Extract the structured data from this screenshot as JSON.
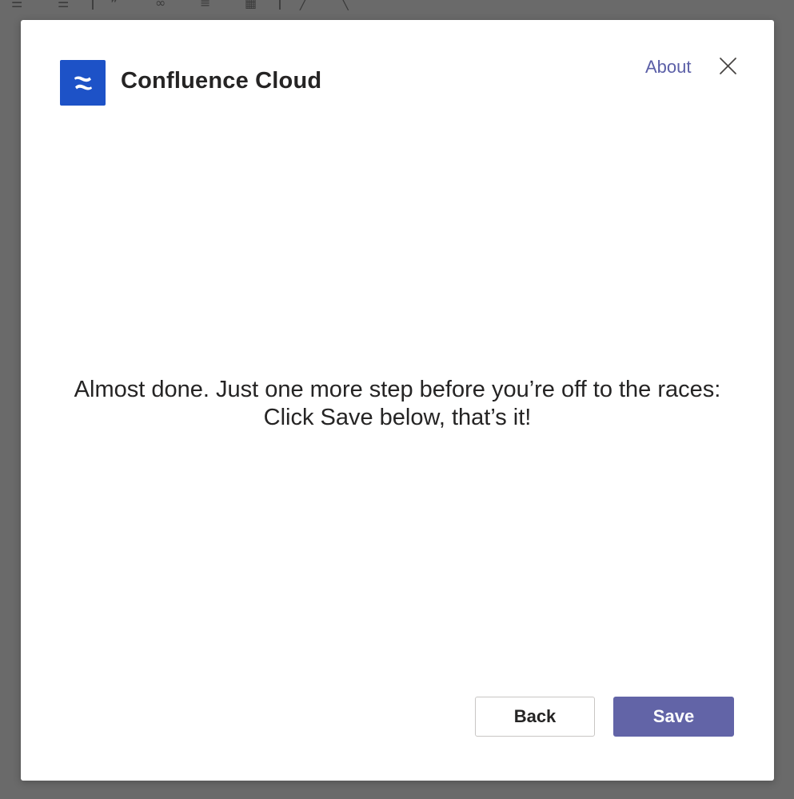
{
  "dialog": {
    "app_name": "Confluence Cloud",
    "about_label": "About",
    "message_line1": "Almost done. Just one more step before you’re off to the races:",
    "message_line2": "Click Save below, that’s it!",
    "back_label": "Back",
    "save_label": "Save"
  },
  "icons": {
    "logo": "confluence-logo-icon",
    "close": "close-icon"
  },
  "colors": {
    "brand_blue": "#1d52c7",
    "accent_purple": "#6264a7",
    "about_link": "#5b5fa7",
    "text": "#252424",
    "overlay": "#6a6a6a"
  }
}
